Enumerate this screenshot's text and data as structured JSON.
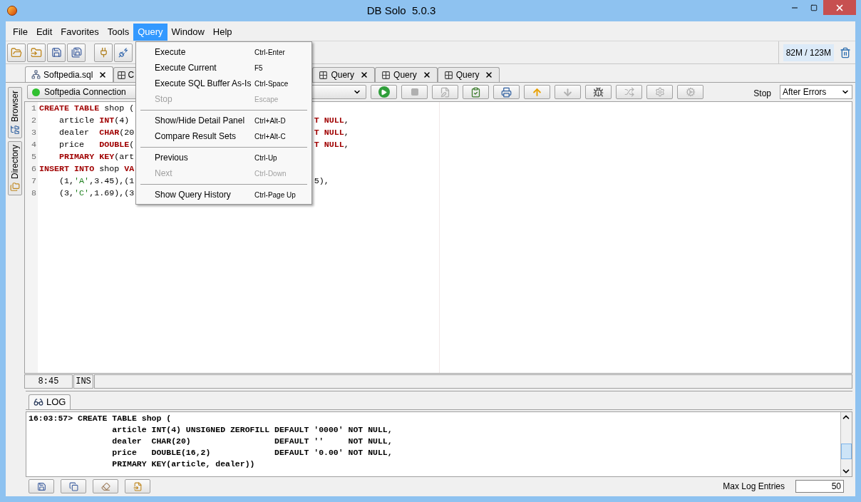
{
  "window": {
    "title": "DB Solo  5.0.3"
  },
  "menu_bar": [
    {
      "label": "File",
      "selected": false
    },
    {
      "label": "Edit",
      "selected": false
    },
    {
      "label": "Favorites",
      "selected": false
    },
    {
      "label": "Tools",
      "selected": false
    },
    {
      "label": "Query",
      "selected": true
    },
    {
      "label": "Window",
      "selected": false
    },
    {
      "label": "Help",
      "selected": false
    }
  ],
  "query_menu": [
    {
      "kind": "item",
      "label": "Execute",
      "shortcut": "Ctrl-Enter",
      "disabled": false
    },
    {
      "kind": "item",
      "label": "Execute Current",
      "shortcut": "F5",
      "disabled": false
    },
    {
      "kind": "item",
      "label": "Execute SQL Buffer As-Is",
      "shortcut": "Ctrl-Space",
      "disabled": false
    },
    {
      "kind": "item",
      "label": "Stop",
      "shortcut": "Escape",
      "disabled": true
    },
    {
      "kind": "separator"
    },
    {
      "kind": "item",
      "label": "Show/Hide Detail Panel",
      "shortcut": "Ctrl+Alt-D",
      "disabled": false
    },
    {
      "kind": "item",
      "label": "Compare Result Sets",
      "shortcut": "Ctrl+Alt-C",
      "disabled": false
    },
    {
      "kind": "separator"
    },
    {
      "kind": "item",
      "label": "Previous",
      "shortcut": "Ctrl-Up",
      "disabled": false
    },
    {
      "kind": "item",
      "label": "Next",
      "shortcut": "Ctrl-Down",
      "disabled": true
    },
    {
      "kind": "separator"
    },
    {
      "kind": "item",
      "label": "Show Query History",
      "shortcut": "Ctrl-Page Up",
      "disabled": false
    }
  ],
  "memory": {
    "usage": "82M / 123M"
  },
  "editor_tabs": [
    {
      "label": "Softpedia.sql",
      "kind": "script",
      "selected": true
    },
    {
      "label": "C",
      "kind": "query",
      "selected": false
    },
    {
      "label": "Query",
      "kind": "query",
      "selected": false
    },
    {
      "label": "Query",
      "kind": "query",
      "selected": false
    },
    {
      "label": "Query",
      "kind": "query",
      "selected": false
    }
  ],
  "side_tabs": [
    {
      "label": "Browser",
      "kind": "browser"
    },
    {
      "label": "Directory",
      "kind": "directory"
    }
  ],
  "connection": {
    "name": "Softpedia Connection"
  },
  "query_toolbar": [
    {
      "kind": "run",
      "disabled": false
    },
    {
      "kind": "stop",
      "disabled": true
    },
    {
      "kind": "edit",
      "disabled": true
    },
    {
      "kind": "check",
      "disabled": false
    },
    {
      "kind": "print",
      "disabled": false
    },
    {
      "kind": "up",
      "disabled": false
    },
    {
      "kind": "down",
      "disabled": true
    },
    {
      "kind": "debug",
      "disabled": false
    },
    {
      "kind": "convert",
      "disabled": true
    },
    {
      "kind": "plan",
      "disabled": true
    },
    {
      "kind": "options",
      "disabled": true
    }
  ],
  "error_mode": {
    "label": "Stop",
    "value": "After Errors"
  },
  "code_lines": [
    {
      "number": "1",
      "indented": false,
      "left": [
        {
          "text": "CREATE TABLE",
          "kind": "keyword"
        },
        {
          "text": " shop (",
          "kind": "plain"
        }
      ]
    },
    {
      "number": "2",
      "indented": true,
      "left": [
        {
          "text": "article ",
          "kind": "plain"
        },
        {
          "text": "INT",
          "kind": "keyword"
        },
        {
          "text": "(4)",
          "kind": "plain"
        }
      ],
      "right": [
        {
          "text": "T NULL",
          "kind": "keyword"
        },
        {
          "text": ",",
          "kind": "plain"
        }
      ]
    },
    {
      "number": "3",
      "indented": true,
      "left": [
        {
          "text": "dealer  ",
          "kind": "plain"
        },
        {
          "text": "CHAR",
          "kind": "keyword"
        },
        {
          "text": "(20",
          "kind": "plain"
        }
      ],
      "right": [
        {
          "text": "T NULL",
          "kind": "keyword"
        },
        {
          "text": ",",
          "kind": "plain"
        }
      ]
    },
    {
      "number": "4",
      "indented": true,
      "left": [
        {
          "text": "price   ",
          "kind": "plain"
        },
        {
          "text": "DOUBLE",
          "kind": "keyword"
        },
        {
          "text": "(",
          "kind": "plain"
        }
      ],
      "right": [
        {
          "text": "T NULL",
          "kind": "keyword"
        },
        {
          "text": ",",
          "kind": "plain"
        }
      ]
    },
    {
      "number": "5",
      "indented": true,
      "left": [
        {
          "text": "PRIMARY KEY",
          "kind": "keyword"
        },
        {
          "text": "(art",
          "kind": "plain"
        }
      ]
    },
    {
      "number": "6",
      "indented": false,
      "left": [
        {
          "text": "INSERT INTO",
          "kind": "keyword"
        },
        {
          "text": " shop ",
          "kind": "plain"
        },
        {
          "text": "VA",
          "kind": "keyword"
        }
      ]
    },
    {
      "number": "7",
      "indented": true,
      "left": [
        {
          "text": "(1,",
          "kind": "plain"
        },
        {
          "text": "'A'",
          "kind": "string"
        },
        {
          "text": ",3.45),(1",
          "kind": "plain"
        }
      ],
      "right": [
        {
          "text": "5),",
          "kind": "plain"
        }
      ]
    },
    {
      "number": "8",
      "indented": true,
      "left": [
        {
          "text": "(3,",
          "kind": "plain"
        },
        {
          "text": "'C'",
          "kind": "string"
        },
        {
          "text": ",1.69),(3",
          "kind": "plain"
        }
      ]
    }
  ],
  "editor_status": {
    "position": "8:45",
    "mode": "INS"
  },
  "log": {
    "tab": "LOG",
    "entries": [
      {
        "time": "16:03:57>",
        "first": "CREATE TABLE shop (",
        "lines": [
          "article INT(4) UNSIGNED ZEROFILL DEFAULT '0000' NOT NULL,",
          "dealer  CHAR(20)                 DEFAULT ''     NOT NULL,",
          "price   DOUBLE(16,2)             DEFAULT '0.00' NOT NULL,",
          "PRIMARY KEY(article, dealer))"
        ]
      }
    ],
    "max_entries_label": "Max Log Entries",
    "max_entries": "50"
  }
}
